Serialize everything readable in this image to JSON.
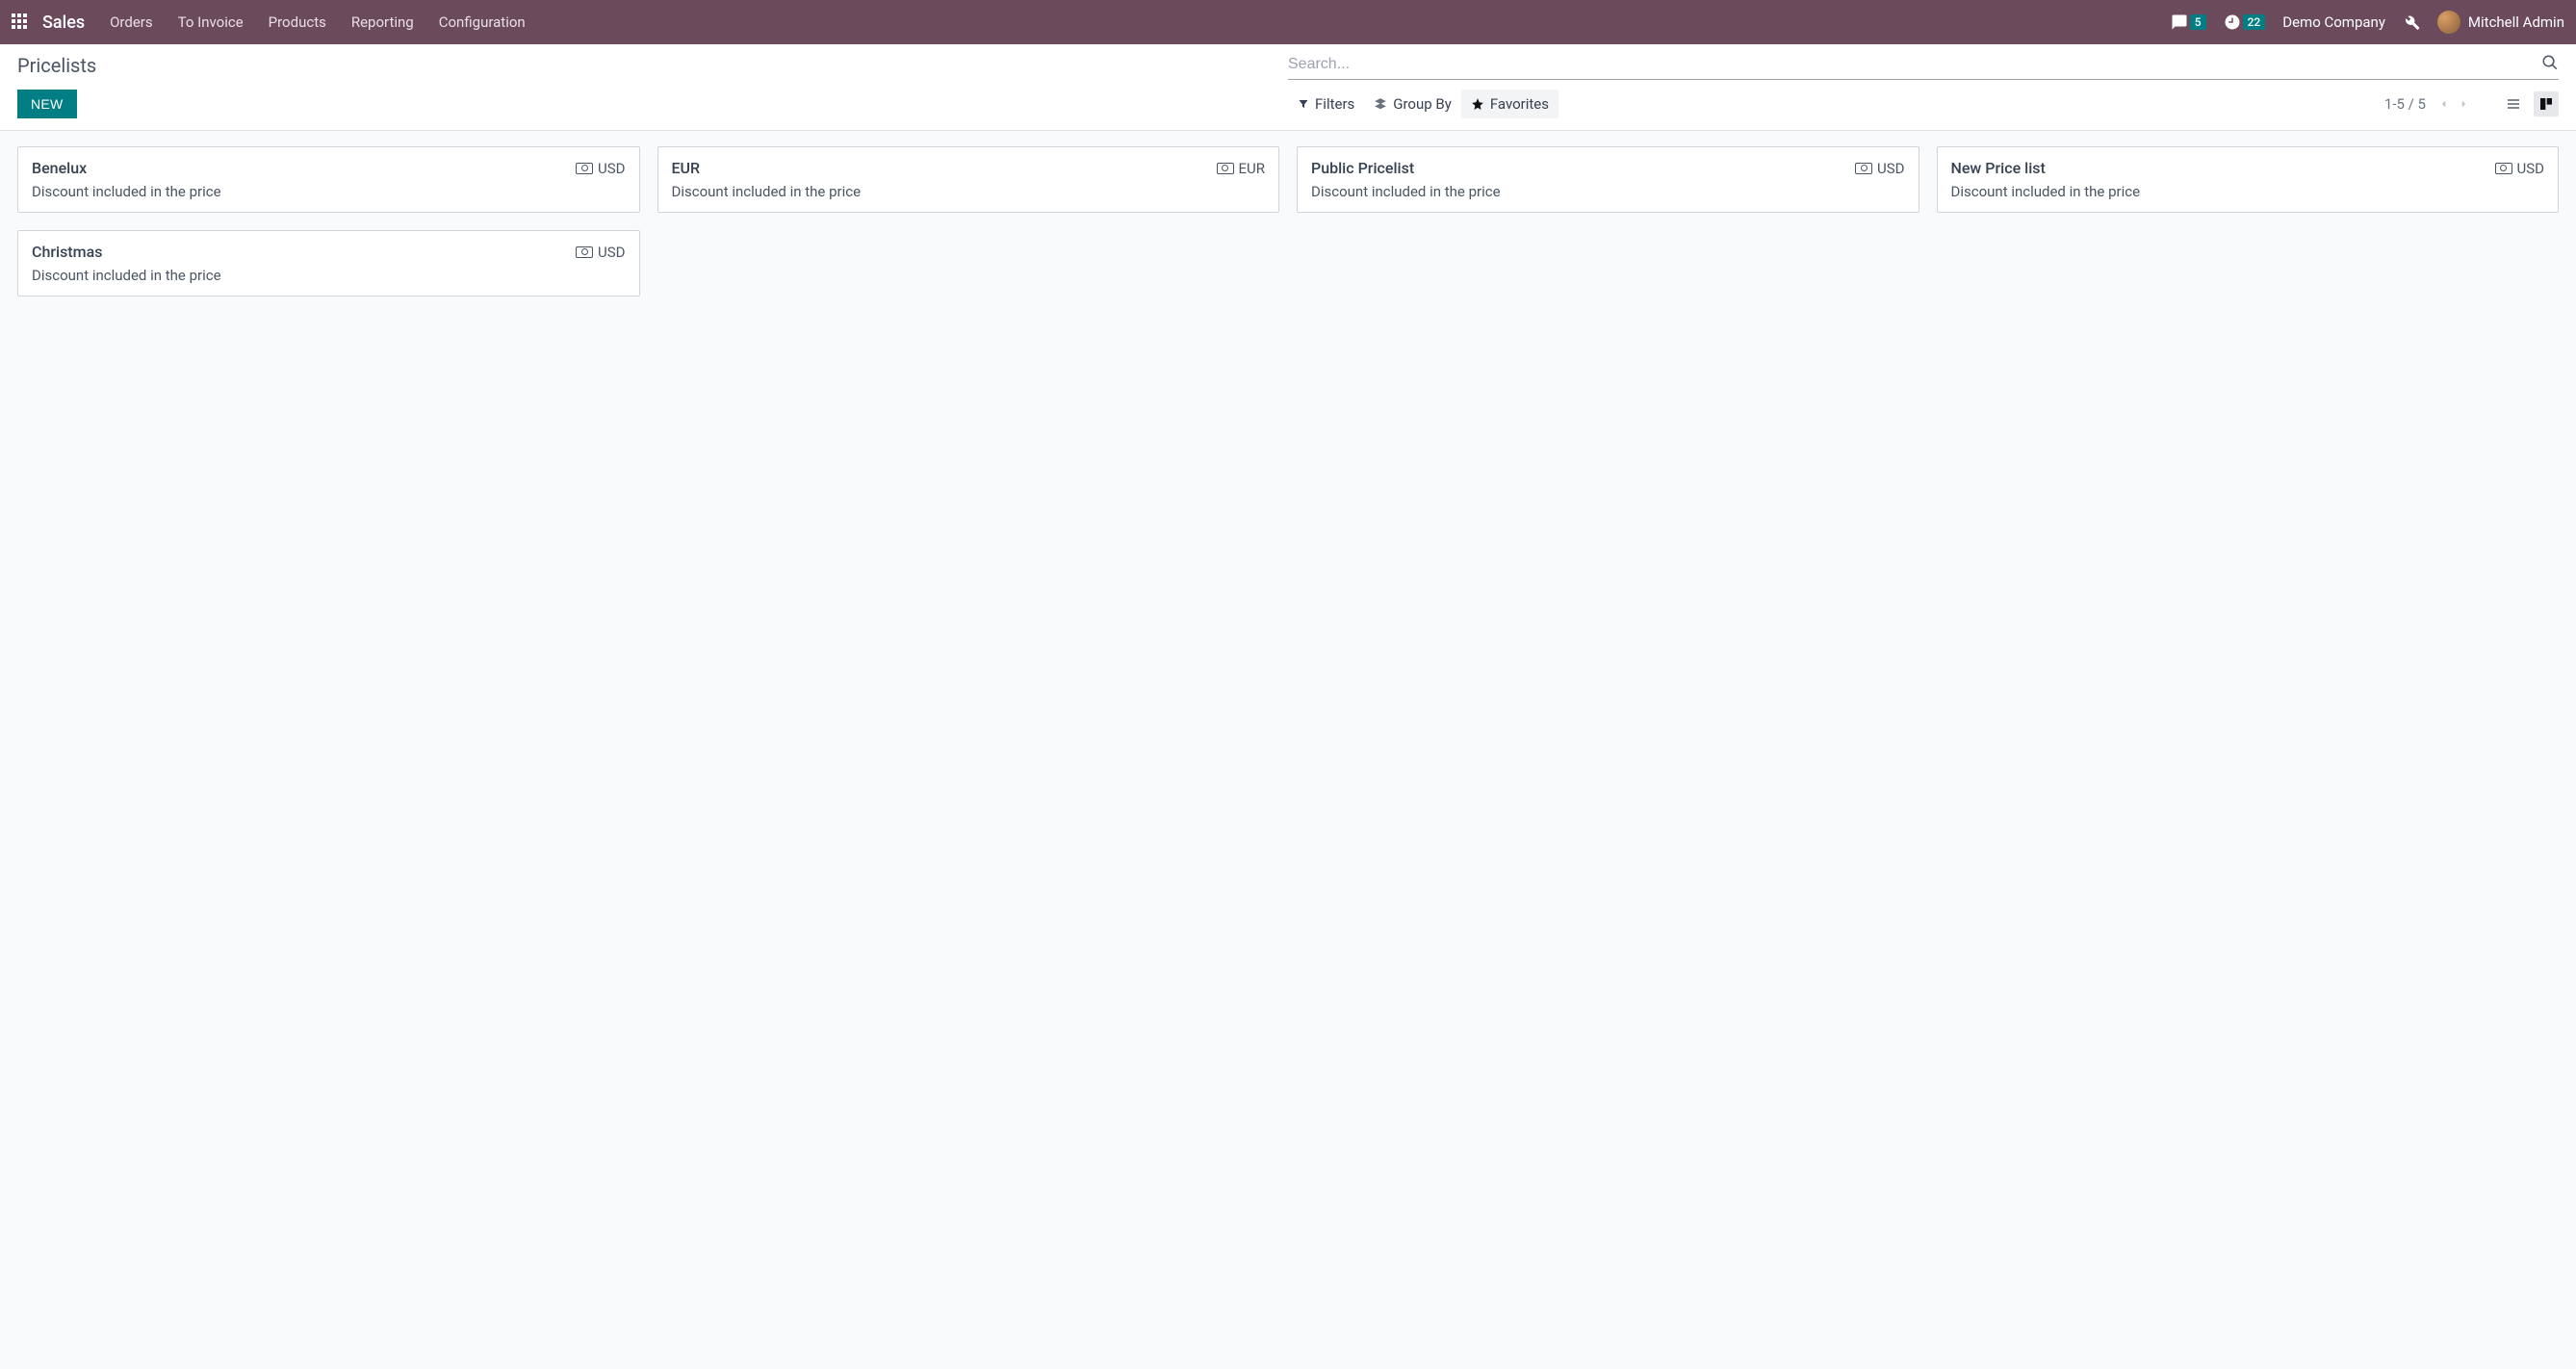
{
  "navbar": {
    "brand": "Sales",
    "menu": [
      "Orders",
      "To Invoice",
      "Products",
      "Reporting",
      "Configuration"
    ],
    "discuss_badge": "5",
    "activities_badge": "22",
    "company": "Demo Company",
    "user": "Mitchell Admin"
  },
  "control": {
    "title": "Pricelists",
    "search_placeholder": "Search...",
    "new_button": "NEW",
    "filters_label": "Filters",
    "groupby_label": "Group By",
    "favorites_label": "Favorites",
    "pager": "1-5 / 5"
  },
  "cards": [
    {
      "name": "Benelux",
      "currency": "USD",
      "desc": "Discount included in the price"
    },
    {
      "name": "EUR",
      "currency": "EUR",
      "desc": "Discount included in the price"
    },
    {
      "name": "Public Pricelist",
      "currency": "USD",
      "desc": "Discount included in the price"
    },
    {
      "name": "New Price list",
      "currency": "USD",
      "desc": "Discount included in the price"
    },
    {
      "name": "Christmas",
      "currency": "USD",
      "desc": "Discount included in the price"
    }
  ]
}
